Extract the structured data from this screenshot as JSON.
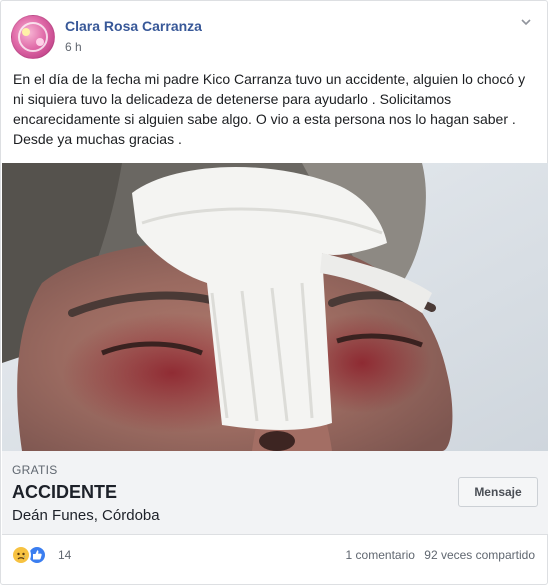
{
  "post": {
    "author": "Clara Rosa Carranza",
    "time": "6 h",
    "text": "En el día de la fecha mi padre Kico Carranza tuvo un accidente, alguien lo chocó y ni siquiera tuvo la delicadeza de detenerse para ayudarlo . Solicitamos encarecidamente si alguien sabe algo. O vio a esta persona nos lo hagan saber . Desde ya muchas gracias ."
  },
  "listing": {
    "price": "GRATIS",
    "title": "ACCIDENTE",
    "location": "Deán Funes, Córdoba",
    "button": "Mensaje"
  },
  "footer": {
    "reaction_icons": [
      "sad-icon",
      "like-icon"
    ],
    "reaction_count": "14",
    "comments": "1 comentario",
    "shares": "92 veces compartido"
  },
  "colors": {
    "author_link": "#385898",
    "listing_bg": "#f2f3f5",
    "like_blue": "#3b7ef0",
    "sad_yellow": "#f7c241"
  }
}
